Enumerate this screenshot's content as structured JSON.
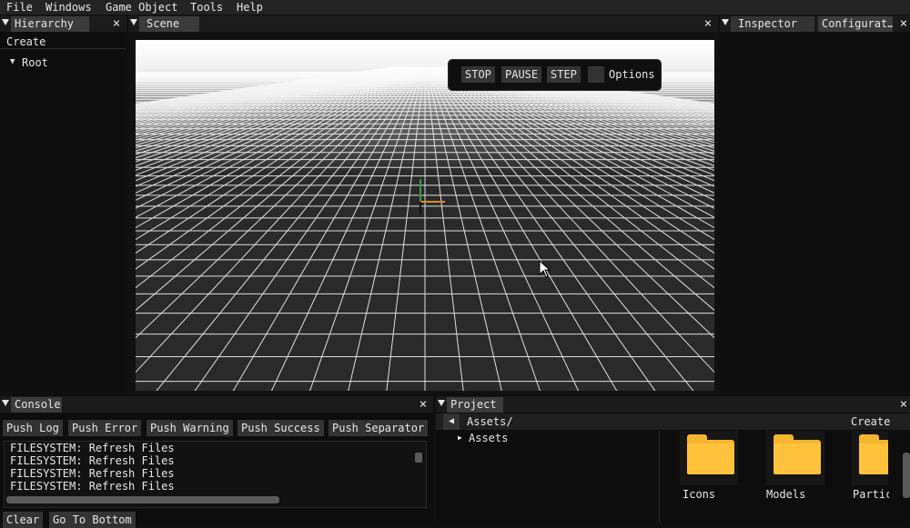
{
  "menubar": {
    "items": [
      "File",
      "Windows",
      "Game Object",
      "Tools",
      "Help"
    ]
  },
  "hierarchy": {
    "tab": "Hierarchy",
    "create_label": "Create",
    "root_label": "Root"
  },
  "scene": {
    "tab": "Scene",
    "controls": {
      "stop": "STOP",
      "pause": "PAUSE",
      "step": "STEP",
      "options": "Options"
    }
  },
  "inspector": {
    "tabs": [
      "Inspector",
      "Configurat…"
    ]
  },
  "console": {
    "tab": "Console",
    "buttons": [
      "Push Log",
      "Push Error",
      "Push Warning",
      "Push Success",
      "Push Separator"
    ],
    "lines": [
      "FILESYSTEM: Refresh Files",
      "FILESYSTEM: Refresh Files",
      "FILESYSTEM: Refresh Files",
      "FILESYSTEM: Refresh Files"
    ],
    "bottom_buttons": [
      "Clear",
      "Go To Bottom"
    ]
  },
  "project": {
    "tab": "Project",
    "path": "Assets/",
    "create_label": "Create",
    "tree_item": "Assets",
    "folders": [
      "Icons",
      "Models",
      "Partic"
    ]
  },
  "colors": {
    "folder": "#f4b52f",
    "grid_bg": "#2a2a2a",
    "axis_x": "#e08a2a",
    "axis_y": "#2ea043"
  }
}
